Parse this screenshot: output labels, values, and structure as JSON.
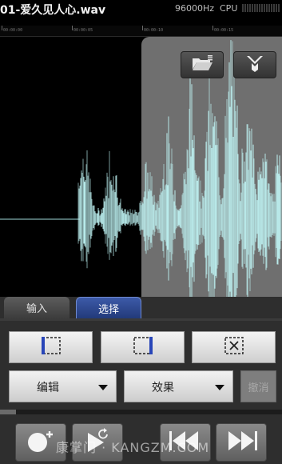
{
  "header": {
    "file_name": "01-爱久见人心.wav",
    "sample_rate": "96000Hz",
    "cpu_label": "CPU"
  },
  "timeline": {
    "ticks": [
      "00:00:00",
      "00:00:05",
      "00:00:10",
      "00:00:15"
    ]
  },
  "toolbar": {
    "open_icon": "folder-open-icon",
    "trim_icon": "crop-wave-icon"
  },
  "tabs": [
    {
      "label": "输入",
      "active": false
    },
    {
      "label": "选择",
      "active": true
    }
  ],
  "selection_tools": {
    "select_start_icon": "select-left-icon",
    "select_end_icon": "select-right-icon",
    "clear_selection_icon": "clear-selection-icon"
  },
  "menus": {
    "edit_label": "编辑",
    "effects_label": "效果",
    "undo_label": "撤消"
  },
  "transport": {
    "record_icon": "record-add-icon",
    "play_icon": "play-loop-icon",
    "rewind_icon": "rewind-to-start-icon",
    "forward_icon": "forward-to-end-icon"
  },
  "watermark": "康掌门 · KANGZM.COM",
  "colors": {
    "waveform": "#bff4f4",
    "selection": "#6f6f6f",
    "active_tab": "#2f4a95",
    "accent_blue": "#2845b8"
  }
}
